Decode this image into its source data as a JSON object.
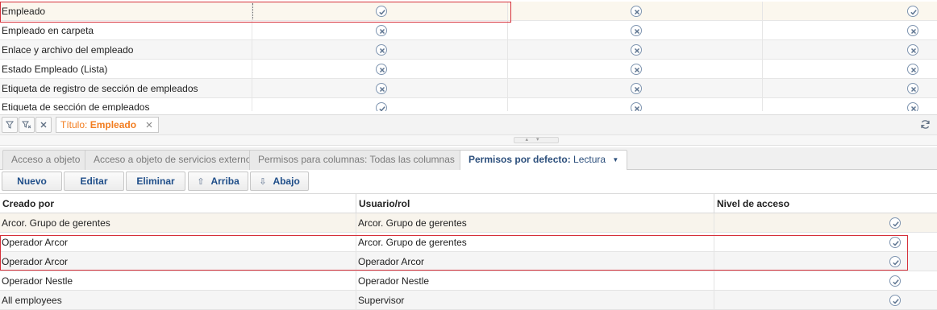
{
  "top_grid": {
    "rows": [
      {
        "name": "Empleado",
        "perms": [
          "check",
          "cross",
          "check"
        ]
      },
      {
        "name": "Empleado en carpeta",
        "perms": [
          "cross",
          "cross",
          "cross"
        ]
      },
      {
        "name": "Enlace y archivo del empleado",
        "perms": [
          "cross",
          "cross",
          "cross"
        ]
      },
      {
        "name": "Estado Empleado (Lista)",
        "perms": [
          "cross",
          "cross",
          "cross"
        ]
      },
      {
        "name": "Etiqueta de registro de sección de empleados",
        "perms": [
          "cross",
          "cross",
          "cross"
        ]
      },
      {
        "name": "Etiqueta de sección de empleados",
        "perms": [
          "check",
          "cross",
          "cross"
        ]
      }
    ]
  },
  "filter_bar": {
    "filter_label": "Título:",
    "filter_value": "Empleado",
    "filter_icon": "funnel-icon",
    "filter_clear_icon": "funnel-clear-icon",
    "close_icon": "close-icon",
    "refresh_icon": "refresh-icon"
  },
  "tabs": [
    {
      "label": "Acceso a objeto",
      "value": ""
    },
    {
      "label": "Acceso a objeto de servicios externos",
      "value": ""
    },
    {
      "label": "Permisos para columnas:",
      "value": "Todas las columnas"
    },
    {
      "label": "Permisos por defecto:",
      "value": "Lectura"
    }
  ],
  "toolbar": {
    "new": "Nuevo",
    "edit": "Editar",
    "delete": "Eliminar",
    "up": "Arriba",
    "down": "Abajo"
  },
  "bottom_grid": {
    "headers": [
      "Creado por",
      "Usuario/rol",
      "Nivel de acceso"
    ],
    "rows": [
      {
        "created_by": "Arcor. Grupo de gerentes",
        "user_role": "Arcor. Grupo de gerentes",
        "access": "check"
      },
      {
        "created_by": "Operador Arcor",
        "user_role": "Arcor. Grupo de gerentes",
        "access": "check"
      },
      {
        "created_by": "Operador Arcor",
        "user_role": "Operador Arcor",
        "access": "check"
      },
      {
        "created_by": "Operador Nestle",
        "user_role": "Operador Nestle",
        "access": "check"
      },
      {
        "created_by": "All employees",
        "user_role": "Supervisor",
        "access": "check"
      }
    ]
  },
  "colors": {
    "accent_orange": "#f27d20",
    "button_text": "#1f4e89",
    "highlight_border": "#d6303a",
    "icon_stroke": "#5e7591"
  }
}
